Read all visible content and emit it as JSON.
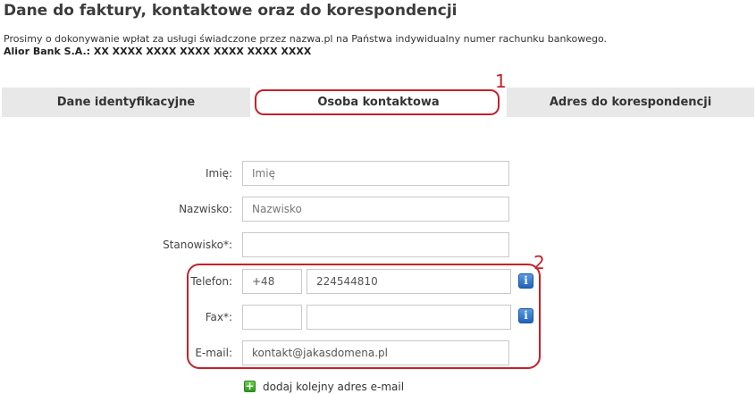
{
  "header": {
    "title": "Dane do faktury, kontaktowe oraz do korespondencji",
    "intro": "Prosimy o dokonywanie wpłat za usługi świadczone przez nazwa.pl na Państwa indywidualny numer rachunku bankowego.",
    "bank": "Alior Bank S.A.: XX XXXX XXXX XXXX XXXX XXXX XXXX"
  },
  "tabs": [
    {
      "label": "Dane identyfikacyjne",
      "active": false
    },
    {
      "label": "Osoba kontaktowa",
      "active": true
    },
    {
      "label": "Adres do korespondencji",
      "active": false
    }
  ],
  "annotations": {
    "marker1": "1",
    "marker2": "2"
  },
  "form": {
    "first_name": {
      "label": "Imię:",
      "value": "",
      "placeholder": "Imię"
    },
    "last_name": {
      "label": "Nazwisko:",
      "value": "",
      "placeholder": "Nazwisko"
    },
    "position": {
      "label": "Stanowisko*:",
      "value": "",
      "placeholder": ""
    },
    "phone": {
      "label": "Telefon:",
      "prefix": "+48",
      "number": "224544810"
    },
    "fax": {
      "label": "Fax*:",
      "prefix": "",
      "number": ""
    },
    "email": {
      "label": "E-mail:",
      "value": "kontakt@jakasdomena.pl"
    },
    "info_icon_glyph": "i",
    "add_email_label": "dodaj kolejny adres e-mail",
    "add_icon_glyph": "+"
  },
  "colors": {
    "highlight": "#c8202a",
    "tab_bg": "#e8e8e8",
    "info_icon": "#2a6fc4",
    "add_icon": "#3aa52a"
  }
}
